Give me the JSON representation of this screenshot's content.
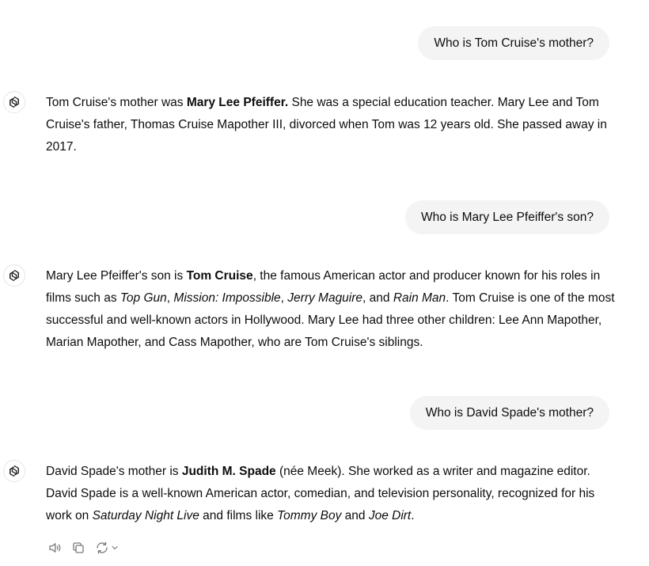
{
  "conversation": {
    "turns": [
      {
        "user": "Who is Tom Cruise's mother?",
        "assistant": [
          "Tom Cruise's mother was ",
          "Mary Lee Pfeiffer.",
          " She was a special education teacher. Mary Lee and Tom Cruise's father, Thomas Cruise Mapother III, divorced when Tom was 12 years old. She passed away in 2017."
        ]
      },
      {
        "user": "Who is Mary Lee Pfeiffer's son?",
        "assistant": [
          "Mary Lee Pfeiffer's son is ",
          "Tom Cruise",
          ", the famous American actor and producer known for his roles in films such as ",
          "Top Gun",
          ", ",
          "Mission: Impossible",
          ", ",
          "Jerry Maguire",
          ", and ",
          "Rain Man",
          ". Tom Cruise is one of the most successful and well-known actors in Hollywood. Mary Lee had three other children: Lee Ann Mapother, Marian Mapother, and Cass Mapother, who are Tom Cruise's siblings."
        ]
      },
      {
        "user": "Who is David Spade's mother?",
        "assistant": [
          "David Spade's mother is ",
          "Judith M. Spade",
          " (née Meek). She worked as a writer and magazine editor. David Spade is a well-known American actor, comedian, and television personality, recognized for his work on ",
          "Saturday Night Live",
          " and films like ",
          "Tommy Boy",
          " and ",
          "Joe Dirt",
          "."
        ]
      }
    ]
  },
  "actions": {
    "icons": [
      "read-aloud-icon",
      "copy-icon",
      "regenerate-icon",
      "chevron-down-icon"
    ]
  }
}
